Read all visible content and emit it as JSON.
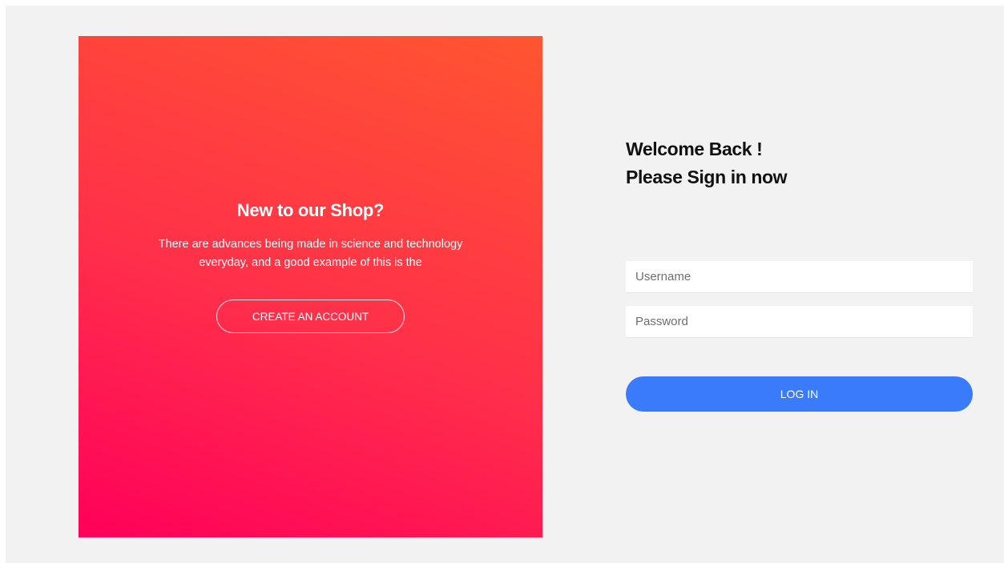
{
  "promo": {
    "title": "New to our Shop?",
    "description": "There are advances being made in science and technology everyday, and a good example of this is the",
    "create_account_label": "CREATE AN ACCOUNT"
  },
  "login": {
    "welcome_line1": "Welcome Back !",
    "welcome_line2": "Please Sign in now",
    "username_placeholder": "Username",
    "password_placeholder": "Password",
    "login_label": "LOG IN"
  },
  "colors": {
    "gradient_start": "#ff005a",
    "gradient_end": "#ff5530",
    "login_button": "#3a7bfb",
    "background": "#f2f2f2"
  }
}
